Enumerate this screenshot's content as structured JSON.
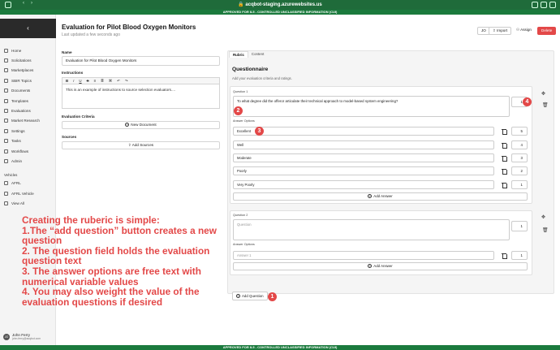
{
  "browser": {
    "url": "acqbot-staging.azurewebsites.us"
  },
  "banner": {
    "top": "APPROVED FOR IL5 - CONTROLLED UNCLASSIFIED INFORMATION (CUI)",
    "bottom": "APPROVED FOR IL5 - CONTROLLED UNCLASSIFIED INFORMATION (CUI)"
  },
  "sidebar": {
    "collapse_icon": "chevron-left-icon",
    "items": [
      {
        "label": "Home",
        "icon": "home-icon"
      },
      {
        "label": "Solicitations",
        "icon": "file-icon"
      },
      {
        "label": "Marketplaces",
        "icon": "store-icon"
      },
      {
        "label": "SBIR Topics",
        "icon": "tag-icon"
      },
      {
        "label": "Documents",
        "icon": "document-icon"
      },
      {
        "label": "Templates",
        "icon": "template-icon"
      },
      {
        "label": "Evaluations",
        "icon": "check-icon"
      },
      {
        "label": "Market Research",
        "icon": "search-icon"
      },
      {
        "label": "Settings",
        "icon": "gear-icon"
      },
      {
        "label": "Tasks",
        "icon": "tasks-icon"
      },
      {
        "label": "Workflows",
        "icon": "workflow-icon"
      },
      {
        "label": "Admin",
        "icon": "admin-icon"
      }
    ],
    "vehicles_heading": "Vehicles",
    "vehicles": [
      {
        "label": "AFRL",
        "icon": "vehicle-icon"
      },
      {
        "label": "AFRL Vehicle",
        "icon": "vehicle-icon"
      },
      {
        "label": "View All",
        "icon": "list-icon"
      }
    ],
    "user": {
      "initials": "JO",
      "name": "John Ferry",
      "email": "john.ferry@acqbot.com"
    }
  },
  "header": {
    "title": "Evaluation for Pilot Blood Oxygen Monitors",
    "subtitle": "Last updated a few seconds ago",
    "assignee_initials": "JO",
    "import_label": "Import",
    "assign_label": "Assign",
    "delete_label": "Delete"
  },
  "form": {
    "name_label": "Name",
    "name_value": "Evaluation for Pilot Blood Oxygen Monitors",
    "instructions_label": "Instructions",
    "toolbar": [
      "B",
      "I",
      "U",
      "S",
      "≡",
      "≣",
      "⌘",
      "↶",
      "↷"
    ],
    "instructions_value": "This is an example of instructions to source selection evaluators....",
    "criteria_label": "Evaluation Criteria",
    "new_document_label": "New Document",
    "sources_label": "Sources",
    "add_sources_label": "Add Sources"
  },
  "rubric": {
    "tabs": [
      "Rubric",
      "Content"
    ],
    "heading": "Questionnaire",
    "subheading": "Add your evaluation criteria and ratings.",
    "questions": [
      {
        "label": "Question 1",
        "text": "To what degree did the offeror articulate their technical approach to model-based system engineering?",
        "weight": "1",
        "answer_options_label": "Answer Options",
        "answers": [
          {
            "text": "Excellent",
            "value": "5"
          },
          {
            "text": "Well",
            "value": "4"
          },
          {
            "text": "Moderate",
            "value": "3"
          },
          {
            "text": "Poorly",
            "value": "2"
          },
          {
            "text": "Very Poorly",
            "value": "1"
          }
        ],
        "add_answer_label": "Add Answer"
      },
      {
        "label": "Question 2",
        "placeholder": "Question",
        "weight": "1",
        "answer_options_label": "Answer Options",
        "answers": [
          {
            "placeholder": "Answer 1",
            "value": "1"
          }
        ],
        "add_answer_label": "Add Answer"
      }
    ],
    "add_question_label": "Add Question"
  },
  "markers": [
    "1",
    "2",
    "3",
    "4"
  ],
  "overlay_lines": [
    "Creating the ruberic is simple:",
    "1.The “add question” button creates a new",
    "question",
    "2. The question field holds the evaluation",
    "question text",
    "3. The answer options are free text with",
    "numerical variable values",
    "4. You may also weight the value of the",
    "evaluation questions if desired"
  ],
  "colors": {
    "chrome": "#1f6b3a",
    "banner": "#1b7a3d",
    "accent_red": "#e34848"
  }
}
